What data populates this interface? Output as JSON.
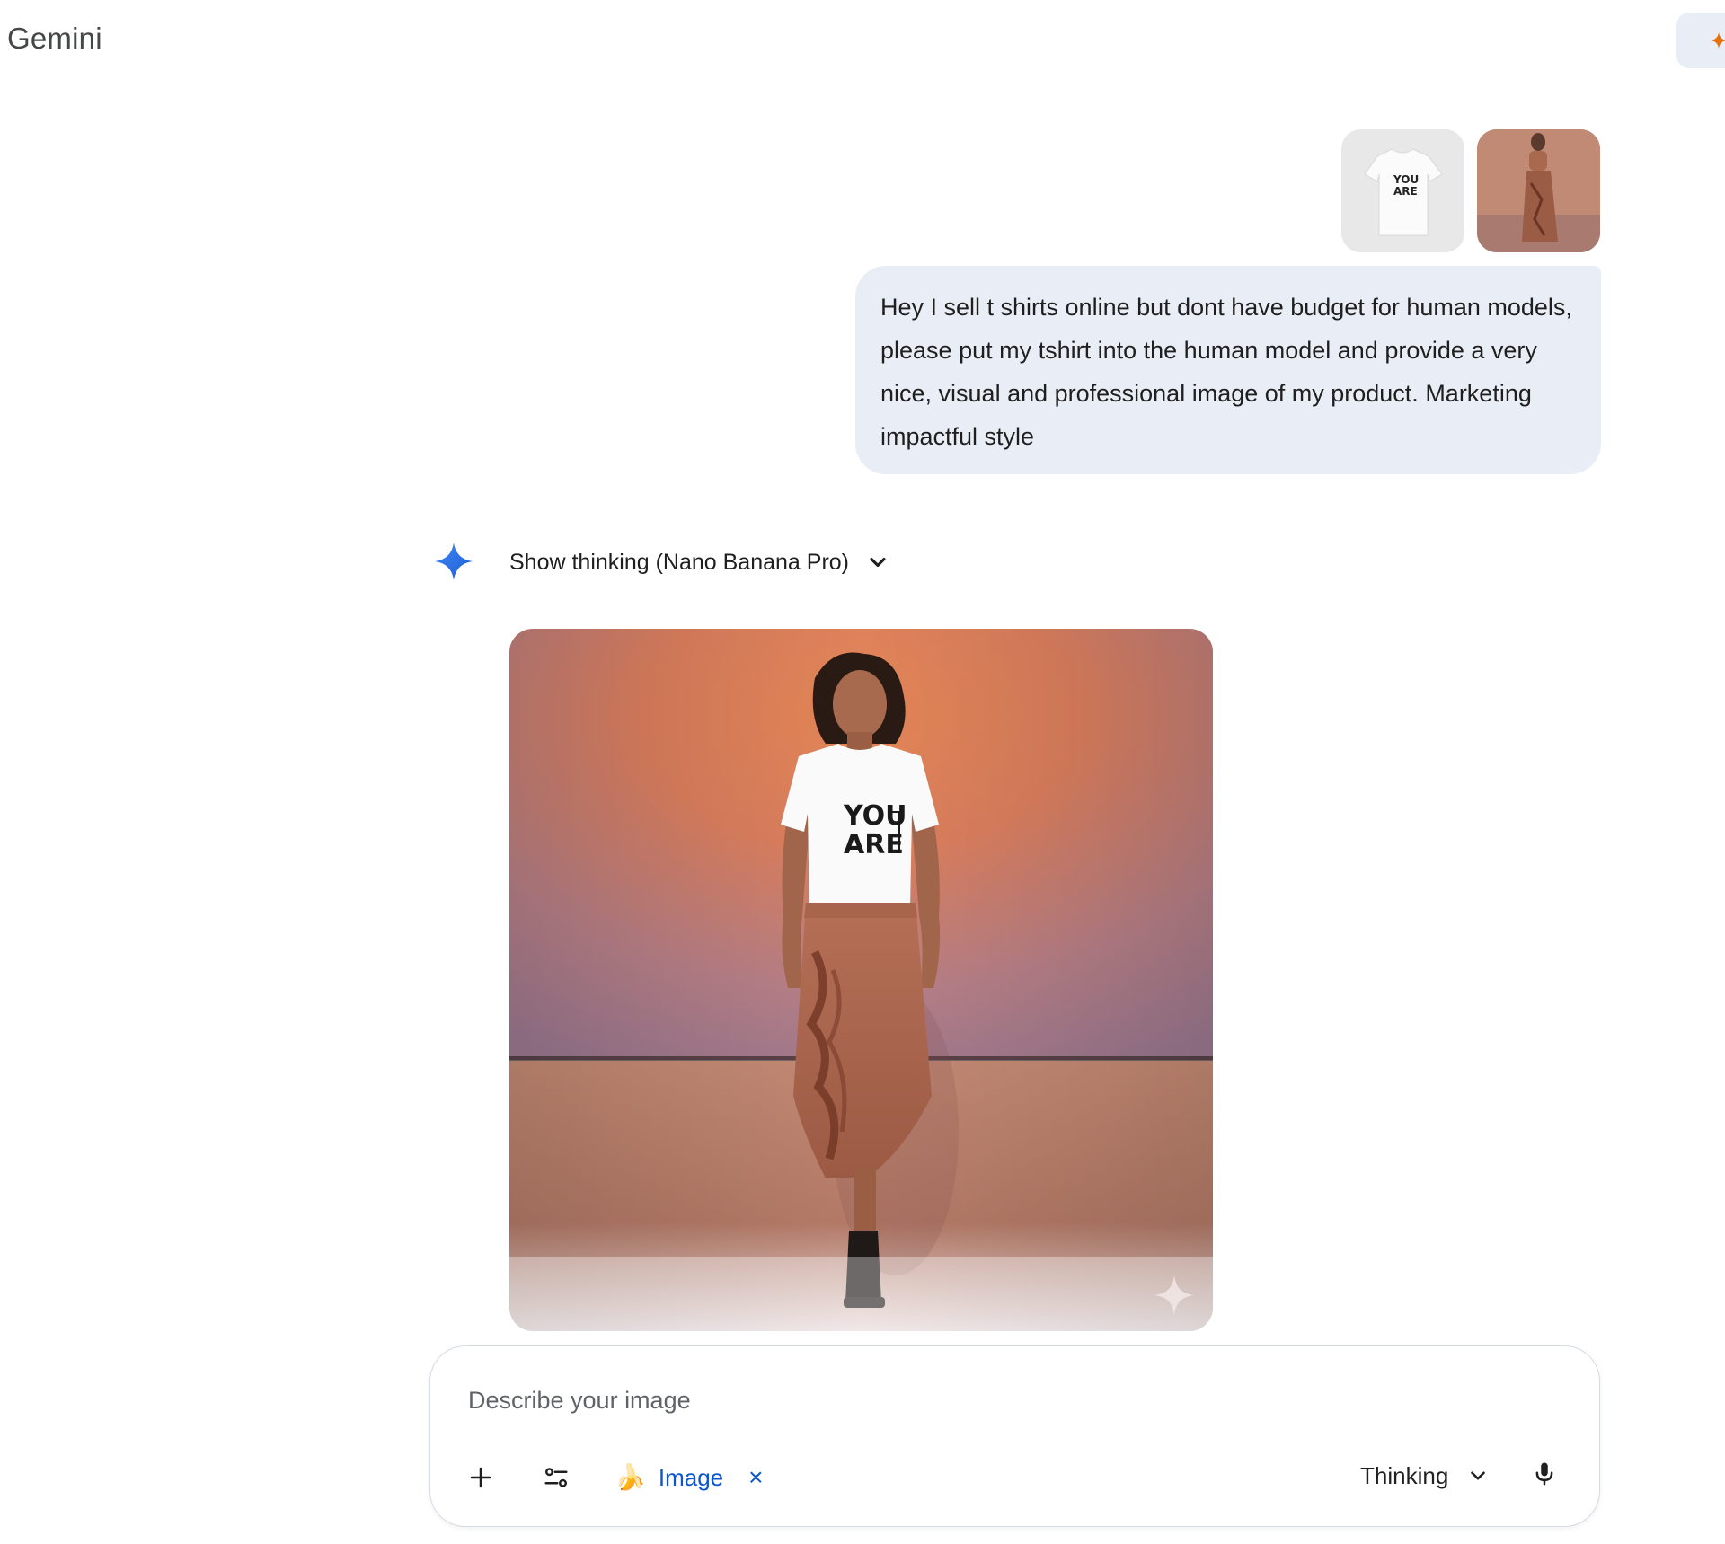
{
  "header": {
    "brand": "Gemini"
  },
  "conversation": {
    "user_message": {
      "attachments": [
        {
          "name": "tshirt-thumbnail",
          "kind": "product photo"
        },
        {
          "name": "model-thumbnail",
          "kind": "model photo"
        }
      ],
      "text": "Hey I sell t shirts online but dont have budget for human models, please put my tshirt into the human model and provide a very nice, visual and professional image of my product. Marketing impactful style"
    },
    "response": {
      "thinking_label": "Show thinking (Nano Banana Pro)",
      "image_shirt_text": [
        "YOU",
        "ARE"
      ]
    }
  },
  "composer": {
    "placeholder": "Describe your image",
    "value": "",
    "chip_label": "Image",
    "chip_close": "×",
    "mode_label": "Thinking"
  },
  "colors": {
    "bubble": "#e9eef6",
    "accent": "#0b57d0",
    "gemini_blue": "#4285f4"
  }
}
